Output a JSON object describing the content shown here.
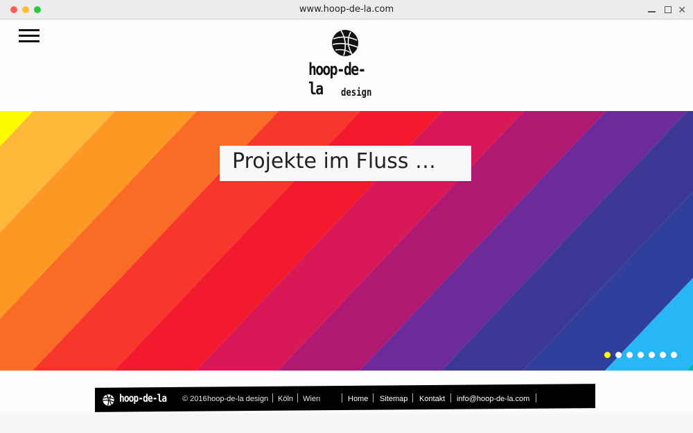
{
  "browser": {
    "url": "www.hoop-de-la.com"
  },
  "header": {
    "logo_main": "hoop-de-la",
    "logo_sub": "design"
  },
  "hero": {
    "title": "Projekte im Fluss …",
    "slide_count": 7,
    "active_slide": 1,
    "stripe_colors": [
      "#fffb00",
      "#fdb739",
      "#fd9825",
      "#fa6b26",
      "#f8372c",
      "#f31a2e",
      "#d91957",
      "#b01972",
      "#6d2b9a",
      "#3c3996",
      "#303f9c",
      "#29b6f4",
      "#05b5a9",
      "#07a796",
      "#00a050",
      "#95d43c",
      "#fffb00"
    ]
  },
  "footer": {
    "logo": "hoop-de-la",
    "copyright": "© 2016",
    "company": "hoop-de-la design",
    "city1": "Köln",
    "city2": "Wien",
    "links": {
      "home": "Home",
      "sitemap": "Sitemap",
      "contact": "Kontakt",
      "email": "info@hoop-de-la.com"
    }
  }
}
